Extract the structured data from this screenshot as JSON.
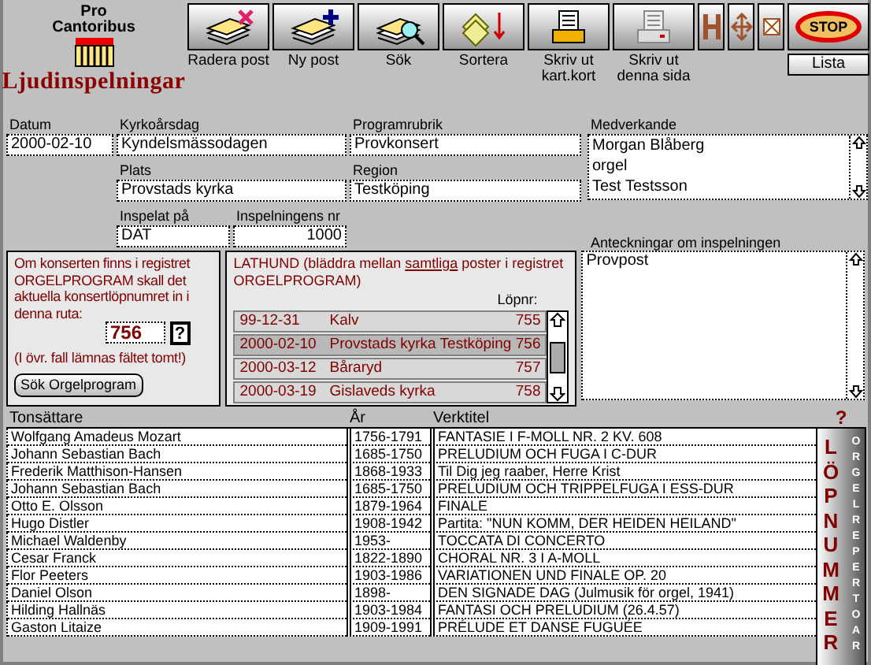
{
  "app": {
    "logo_top": "Pro",
    "logo_name": "Cantoribus",
    "title": "Ljudinspelningar"
  },
  "toolbar": [
    {
      "label": "Radera post",
      "kind": "delete"
    },
    {
      "label": "Ny post",
      "kind": "new"
    },
    {
      "label": "Sök",
      "kind": "search"
    },
    {
      "label": "Sortera",
      "kind": "sort"
    },
    {
      "label": "Skriv ut kart.kort",
      "kind": "print"
    },
    {
      "label": "Skriv ut denna sida",
      "kind": "printpage"
    }
  ],
  "stop_button": "STOP",
  "list_button": "Lista",
  "fields": [
    {
      "label": "Datum",
      "value": "2000-02-10"
    },
    {
      "label": "Kyrkoårsdag",
      "value": "Kyndelsmässodagen"
    },
    {
      "label": "Programrubrik",
      "value": "Provkonsert"
    },
    {
      "label": "Plats",
      "value": "Provstads kyrka"
    },
    {
      "label": "Region",
      "value": "Testköping"
    },
    {
      "label": "Inspelat på",
      "value": "DAT"
    },
    {
      "label": "Inspelningens nr",
      "value": "1000"
    }
  ],
  "participants": {
    "label": "Medverkande",
    "lines": [
      "Morgan Blåberg",
      "orgel",
      "Test Testsson"
    ]
  },
  "notes": {
    "label": "Anteckningar om inspelningen",
    "value": "Provpost"
  },
  "concert_panel": {
    "message": "Om konserten finns i registret ORGELPROGRAM skall det aktuella konsertlöpnumret in i denna ruta:",
    "value": "756",
    "help": "?",
    "note": "(I övr. fall lämnas fältet tomt!)",
    "button": "Sök Orgelprogram"
  },
  "lathund": {
    "title_before": "LATHUND (bläddra mellan ",
    "title_underlined": "samtliga",
    "title_after": " poster i registret ORGELPROGRAM)",
    "number_label": "Löpnr:",
    "rows": [
      {
        "date": "99-12-31",
        "place": "Kalv",
        "number": "755",
        "selected": false
      },
      {
        "date": "2000-02-10",
        "place": "Provstads kyrka Testköping",
        "number": "756",
        "selected": true
      },
      {
        "date": "2000-03-12",
        "place": "Båraryd",
        "number": "757",
        "selected": false
      },
      {
        "date": "2000-03-19",
        "place": "Gislaveds kyrka",
        "number": "758",
        "selected": false
      }
    ]
  },
  "works": {
    "columns": [
      "Tonsättare",
      "År",
      "Verktitel"
    ],
    "rows": [
      [
        "Wolfgang Amadeus Mozart",
        "1756-1791",
        "FANTASIE I F-MOLL NR. 2  KV. 608"
      ],
      [
        "Johann Sebastian  Bach",
        "1685-1750",
        "PRELUDIUM OCH FUGA I C-DUR"
      ],
      [
        "Frederik Matthison-Hansen",
        "1868-1933",
        "Til Dig jeg raaber, Herre Krist"
      ],
      [
        "Johann Sebastian  Bach",
        "1685-1750",
        "PRELUDIUM OCH TRIPPELFUGA I ESS-DUR"
      ],
      [
        "Otto E. Olsson",
        "1879-1964",
        "FINALE"
      ],
      [
        "Hugo Distler",
        "1908-1942",
        "Partita: \"NUN KOMM, DER HEIDEN HEILAND\""
      ],
      [
        "Michael Waldenby",
        "1953-",
        "TOCCATA DI CONCERTO"
      ],
      [
        "Cesar Franck",
        "1822-1890",
        "CHORAL NR. 3 I A-MOLL"
      ],
      [
        "Flor Peeters",
        "1903-1986",
        "VARIATIONEN UND FINALE  OP. 20"
      ],
      [
        "Daniel Olson",
        "1898-",
        "DEN SIGNADE DAG (Julmusik för orgel, 1941)"
      ],
      [
        "Hilding Hallnäs",
        "1903-1984",
        "FANTASI OCH PRELUDIUM  (26.4.57)"
      ],
      [
        "Gaston Litaize",
        "1909-1991",
        "PRÉLUDE ET DANSE FUGUÉE"
      ]
    ],
    "help": "?",
    "side_big": "LÖPNUMMER",
    "side_small": "ORGELREPERTOAR"
  }
}
